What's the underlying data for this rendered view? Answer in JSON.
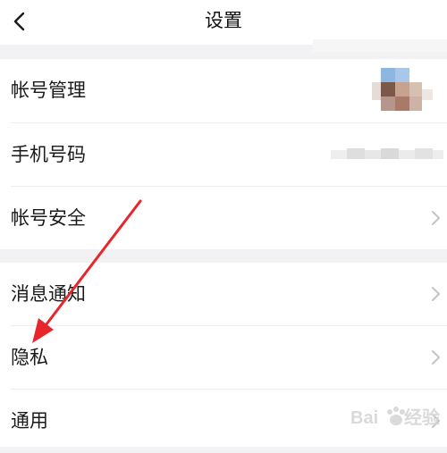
{
  "header": {
    "title": "设置",
    "back_icon": "chevron-left-icon"
  },
  "group1": {
    "items": [
      {
        "label": "帐号管理",
        "value": "blurred-avatar"
      },
      {
        "label": "手机号码",
        "value": "blurred-phone-number"
      },
      {
        "label": "帐号安全",
        "icon": "chevron-right-icon"
      }
    ]
  },
  "group2": {
    "items": [
      {
        "label": "消息通知",
        "icon": "chevron-right-icon"
      },
      {
        "label": "隐私",
        "icon": "chevron-right-icon"
      },
      {
        "label": "通用",
        "icon": "chevron-right-icon"
      }
    ]
  },
  "annotation": {
    "arrow_color": "#e8252a"
  },
  "watermark": {
    "text": "Baidu 经验"
  },
  "colors": {
    "background": "#f2f2f4",
    "row_background": "#ffffff",
    "chevron": "#c4c4c4",
    "text": "#1a1a1a"
  }
}
